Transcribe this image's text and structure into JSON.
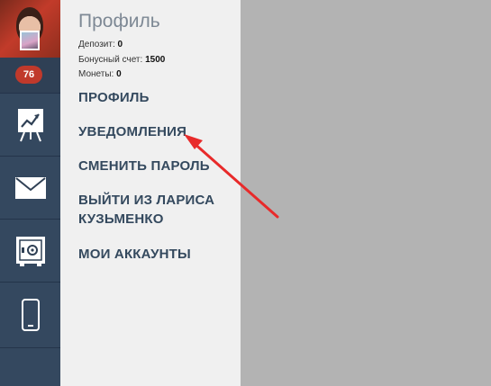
{
  "sidebar": {
    "badge": "76",
    "icons": [
      "chart-icon",
      "mail-icon",
      "safe-icon",
      "phone-icon"
    ]
  },
  "profile": {
    "title": "Профиль",
    "stats": [
      {
        "label": "Депозит:",
        "value": "0"
      },
      {
        "label": "Бонусный счет:",
        "value": "1500"
      },
      {
        "label": "Монеты:",
        "value": "0"
      }
    ]
  },
  "menu": {
    "items": [
      {
        "label": "ПРОФИЛЬ"
      },
      {
        "label": "УВЕДОМЛЕНИЯ"
      },
      {
        "label": "СМЕНИТЬ ПАРОЛЬ"
      },
      {
        "label": "ВЫЙТИ ИЗ ЛАРИСА КУЗЬМЕНКО"
      },
      {
        "label": "МОИ АККАУНТЫ"
      }
    ]
  },
  "colors": {
    "rail": "#2f4055",
    "panel": "#f0f0f0",
    "badge": "#c0392b",
    "menu_text": "#34495e",
    "annotation_arrow": "#e82a2a",
    "overlay": "#b3b3b3"
  }
}
